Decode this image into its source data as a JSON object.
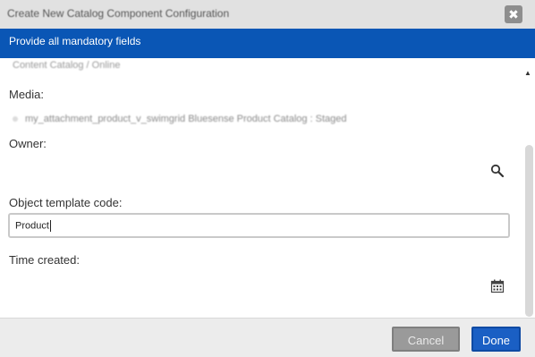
{
  "dialog": {
    "title": "Create New Catalog Component Configuration",
    "close_glyph": "✖"
  },
  "banner": {
    "message": "Provide all mandatory fields"
  },
  "form": {
    "cut_off_text": "Content Catalog / Online",
    "media": {
      "label": "Media:",
      "item": "my_attachment_product_v_swimgrid Bluesense Product Catalog : Staged"
    },
    "owner": {
      "label": "Owner:",
      "value": ""
    },
    "object_template_code": {
      "label": "Object template code:",
      "value": "Product"
    },
    "time_created": {
      "label": "Time created:",
      "value": ""
    }
  },
  "icons": {
    "owner_lookup": "search-icon",
    "time_picker": "calendar-icon"
  },
  "footer": {
    "cancel_label": "Cancel",
    "done_label": "Done"
  },
  "colors": {
    "banner_bg": "#0a56b5",
    "done_bg": "#1a5fc4",
    "cancel_bg": "#9a9a9a"
  }
}
